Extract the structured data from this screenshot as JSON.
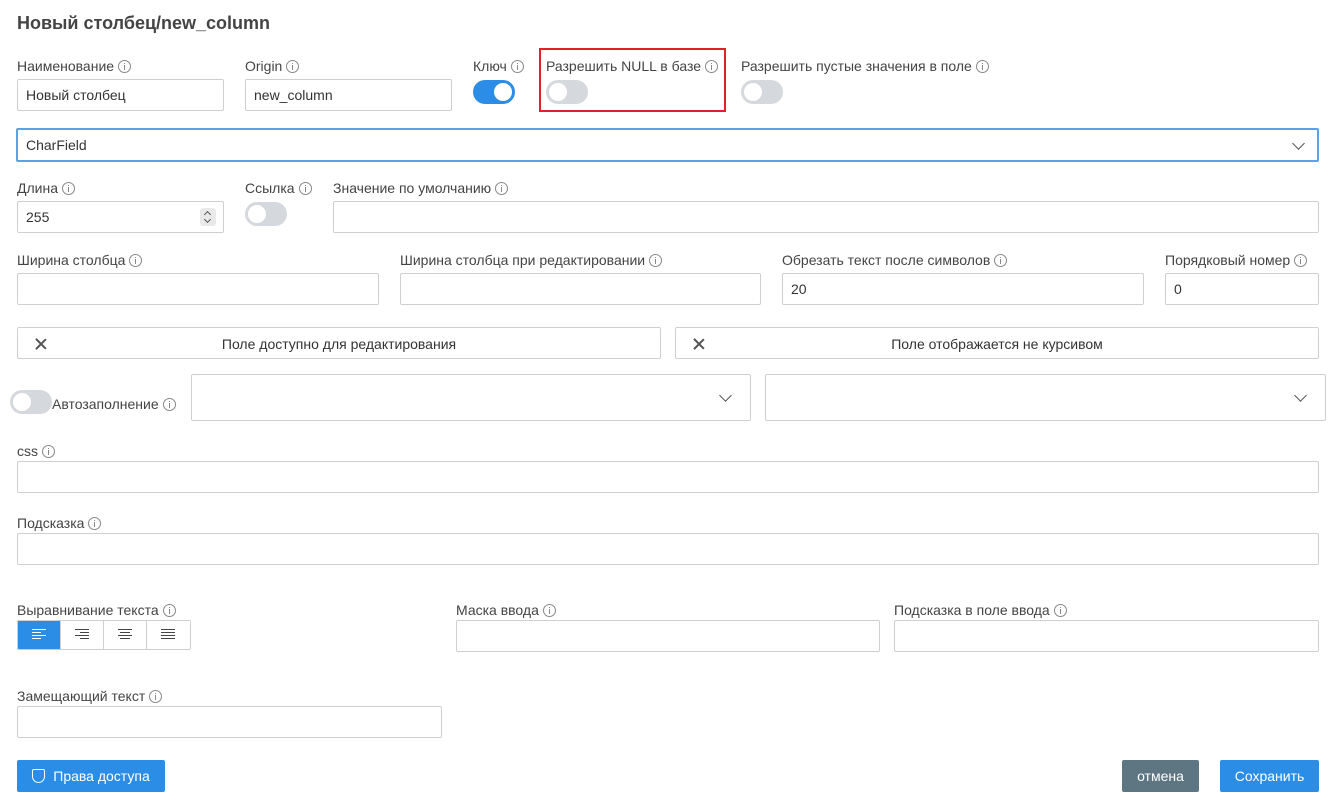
{
  "title": "Новый столбец/new_column",
  "name": {
    "label": "Наименование",
    "value": "Новый столбец"
  },
  "origin": {
    "label": "Origin",
    "value": "new_column"
  },
  "key": {
    "label": "Ключ",
    "on": true
  },
  "allow_null": {
    "label": "Разрешить NULL в базе",
    "on": false
  },
  "allow_blank": {
    "label": "Разрешить пустые значения в поле",
    "on": false
  },
  "field_type": {
    "value": "CharField"
  },
  "length": {
    "label": "Длина",
    "value": "255"
  },
  "link": {
    "label": "Ссылка",
    "on": false
  },
  "default_value": {
    "label": "Значение по умолчанию",
    "value": ""
  },
  "column_width": {
    "label": "Ширина столбца",
    "value": ""
  },
  "edit_width": {
    "label": "Ширина столбца при редактировании",
    "value": ""
  },
  "truncate": {
    "label": "Обрезать текст после символов",
    "value": "20"
  },
  "order": {
    "label": "Порядковый номер",
    "value": "0"
  },
  "editable_chip": {
    "label": "Поле доступно для редактирования"
  },
  "italic_chip": {
    "label": "Поле отображается не курсивом"
  },
  "autofill": {
    "label": "Автозаполнение",
    "on": false
  },
  "css": {
    "label": "css",
    "value": ""
  },
  "hint": {
    "label": "Подсказка",
    "value": ""
  },
  "text_align": {
    "label": "Выравнивание текста",
    "options": [
      "left",
      "right",
      "center",
      "justify"
    ],
    "selected": "left"
  },
  "input_mask": {
    "label": "Маска ввода",
    "value": ""
  },
  "input_hint": {
    "label": "Подсказка в поле ввода",
    "value": ""
  },
  "placeholder": {
    "label": "Замещающий текст",
    "value": ""
  },
  "buttons": {
    "access": "Права доступа",
    "cancel": "отмена",
    "save": "Сохранить"
  },
  "colors": {
    "primary": "#2b8de6",
    "highlight": "#e0202a",
    "cancel": "#5e7582"
  }
}
